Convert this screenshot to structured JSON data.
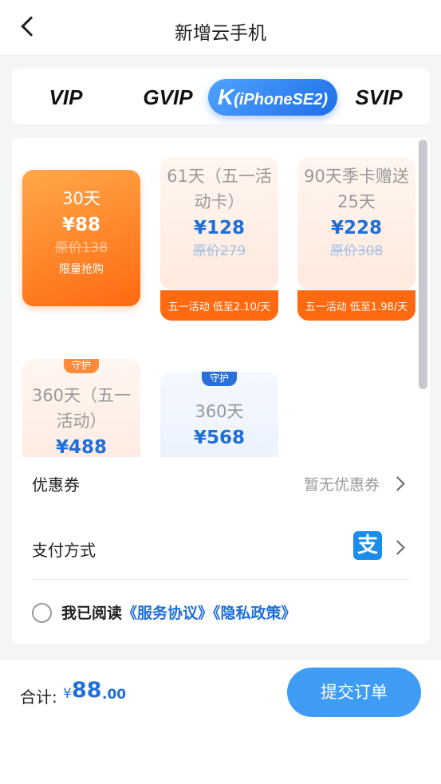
{
  "header": {
    "title": "新增云手机"
  },
  "tabs": [
    {
      "label": "VIP"
    },
    {
      "label": "GVIP"
    },
    {
      "prefix": "K",
      "label": "(iPhoneSE2)"
    },
    {
      "label": "SVIP"
    }
  ],
  "plans": [
    {
      "name": "30天",
      "price": "¥88",
      "original": "原价138",
      "note": "限量抢购"
    },
    {
      "name": "61天（五一活动卡）",
      "price": "¥128",
      "original": "原价279",
      "promo": "五一活动 低至2.10/天"
    },
    {
      "name": "90天季卡赠送25天",
      "price": "¥228",
      "original": "原价308",
      "promo": "五一活动 低至1.98/天"
    },
    {
      "badge": "守护",
      "name": "360天（五一活动）",
      "price": "¥488"
    },
    {
      "badge": "守护",
      "name": "360天",
      "price": "¥568"
    }
  ],
  "coupon": {
    "label": "优惠券",
    "value": "暂无优惠券"
  },
  "payment": {
    "label": "支付方式",
    "icon": "alipay-icon",
    "icon_glyph": "支"
  },
  "agreement": {
    "prefix": "我已阅读",
    "service": "《服务协议》",
    "privacy": "《隐私政策》"
  },
  "footer": {
    "total_label": "合计:",
    "currency": "¥",
    "total_int": "88",
    "total_dec": ".00",
    "submit": "提交订单"
  },
  "colors": {
    "accent": "#1f6fd8",
    "orange": "#ff6a10",
    "button": "#3f9cf5"
  }
}
